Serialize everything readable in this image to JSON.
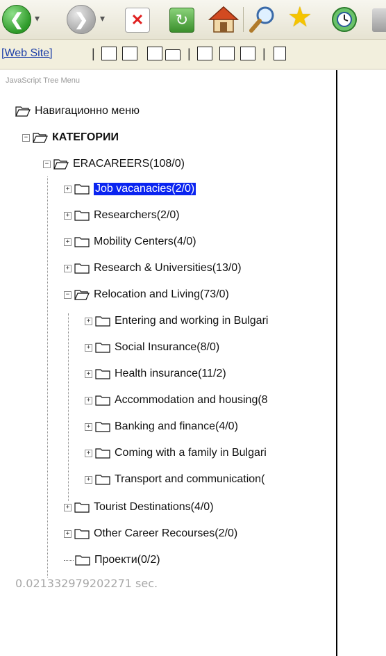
{
  "linkbar": {
    "website_label": "[Web Site]"
  },
  "tree": {
    "title": "JavaScript Tree Menu",
    "root_label": "Навигационно меню",
    "categories_label": "КАТЕГОРИИ",
    "eracareers_label": "ERACAREERS(108/0)",
    "items": [
      "Job vacanacies(2/0)",
      "Researchers(2/0)",
      "Mobility Centers(4/0)",
      "Research & Universities(13/0)",
      "Relocation and Living(73/0)",
      "Tourist Destinations(4/0)",
      "Other Career Recourses(2/0)",
      "Проекти(0/2)"
    ],
    "relocation_children": [
      "Entering and working in Bulgari",
      "Social Insurance(8/0)",
      "Health insurance(11/2)",
      "Accommodation and housing(8",
      "Banking and finance(4/0)",
      "Coming with a family in Bulgari",
      "Transport and communication("
    ],
    "timer": "0.021332979202271 sec."
  },
  "colors": {
    "selected_bg": "#0a24f0",
    "link": "#1d3fa8",
    "timer": "#a7a7a7"
  }
}
